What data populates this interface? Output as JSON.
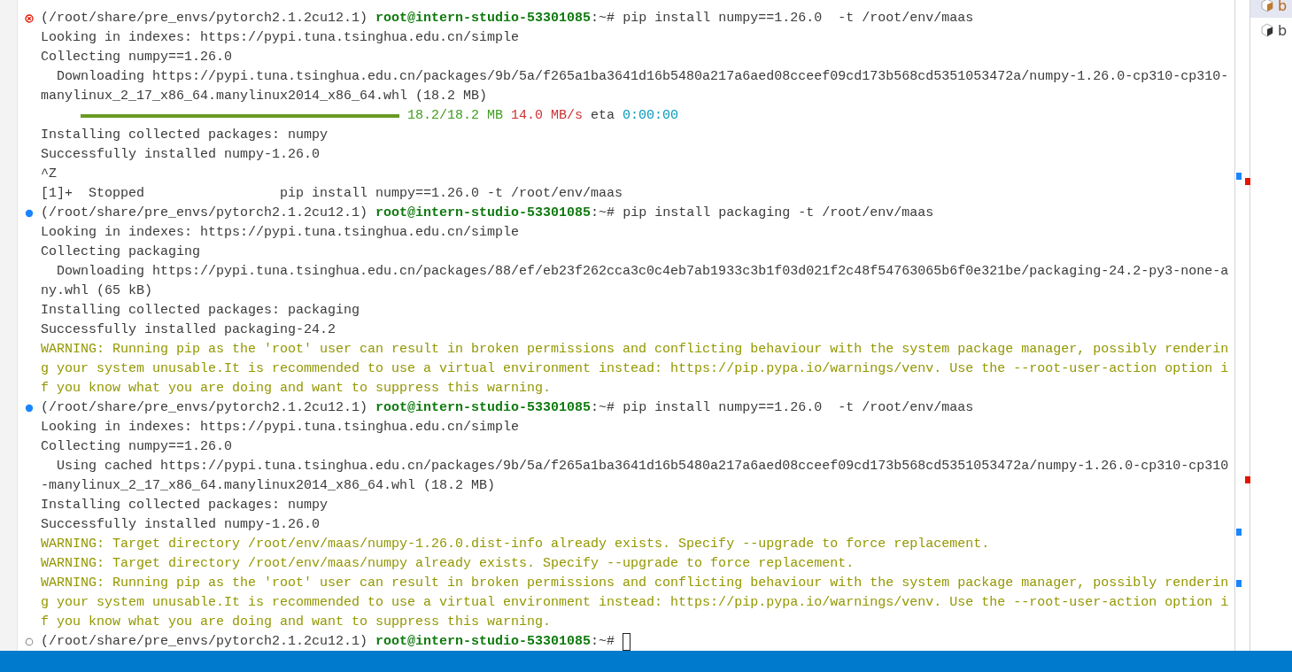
{
  "terminal": {
    "lines": [
      {
        "kind": "prompt",
        "finished": true,
        "failed": true,
        "env": "(/root/share/pre_envs/pytorch2.1.2cu12.1)",
        "userhost": "root@intern-studio-53301085",
        "path": ":~#",
        "command": "pip install numpy==1.26.0  -t /root/env/maas"
      },
      {
        "kind": "output",
        "text": "Looking in indexes: https://pypi.tuna.tsinghua.edu.cn/simple"
      },
      {
        "kind": "output",
        "text": "Collecting numpy==1.26.0"
      },
      {
        "kind": "output",
        "text": "  Downloading https://pypi.tuna.tsinghua.edu.cn/packages/9b/5a/f265a1ba3641d16b5480a217a6aed08cceef09cd173b568cd5351053472a/numpy-1.26.0-cp310-cp310-"
      },
      {
        "kind": "output",
        "text": "manylinux_2_17_x86_64.manylinux2014_x86_64.whl (18.2 MB)"
      },
      {
        "kind": "progress",
        "level": 1,
        "size": "18.2/18.2 MB",
        "speed": "14.0 MB/s",
        "eta_label": "eta",
        "eta": "0:00:00"
      },
      {
        "kind": "output",
        "text": "Installing collected packages: numpy"
      },
      {
        "kind": "output",
        "text": "Successfully installed numpy-1.26.0"
      },
      {
        "kind": "output",
        "text": "^Z"
      },
      {
        "kind": "output",
        "text": "[1]+  Stopped                 pip install numpy==1.26.0 -t /root/env/maas"
      },
      {
        "kind": "prompt",
        "finished": true,
        "failed": false,
        "env": "(/root/share/pre_envs/pytorch2.1.2cu12.1)",
        "userhost": "root@intern-studio-53301085",
        "path": ":~#",
        "command": "pip install packaging -t /root/env/maas"
      },
      {
        "kind": "output",
        "text": "Looking in indexes: https://pypi.tuna.tsinghua.edu.cn/simple"
      },
      {
        "kind": "output",
        "text": "Collecting packaging"
      },
      {
        "kind": "output",
        "text": "  Downloading https://pypi.tuna.tsinghua.edu.cn/packages/88/ef/eb23f262cca3c0c4eb7ab1933c3b1f03d021f2c48f54763065b6f0e321be/packaging-24.2-py3-none-a"
      },
      {
        "kind": "output",
        "text": "ny.whl (65 kB)"
      },
      {
        "kind": "output",
        "text": "Installing collected packages: packaging"
      },
      {
        "kind": "output",
        "text": "Successfully installed packaging-24.2"
      },
      {
        "kind": "warning",
        "text": "WARNING: Running pip as the 'root' user can result in broken permissions and conflicting behaviour with the system package manager, possibly renderin"
      },
      {
        "kind": "warning",
        "text": "g your system unusable.It is recommended to use a virtual environment instead: https://pip.pypa.io/warnings/venv. Use the --root-user-action option i"
      },
      {
        "kind": "warning",
        "text": "f you know what you are doing and want to suppress this warning."
      },
      {
        "kind": "prompt",
        "finished": true,
        "failed": false,
        "env": "(/root/share/pre_envs/pytorch2.1.2cu12.1)",
        "userhost": "root@intern-studio-53301085",
        "path": ":~#",
        "command": "pip install numpy==1.26.0  -t /root/env/maas"
      },
      {
        "kind": "output",
        "text": "Looking in indexes: https://pypi.tuna.tsinghua.edu.cn/simple"
      },
      {
        "kind": "output",
        "text": "Collecting numpy==1.26.0"
      },
      {
        "kind": "output",
        "text": "  Using cached https://pypi.tuna.tsinghua.edu.cn/packages/9b/5a/f265a1ba3641d16b5480a217a6aed08cceef09cd173b568cd5351053472a/numpy-1.26.0-cp310-cp310"
      },
      {
        "kind": "output",
        "text": "-manylinux_2_17_x86_64.manylinux2014_x86_64.whl (18.2 MB)"
      },
      {
        "kind": "output",
        "text": "Installing collected packages: numpy"
      },
      {
        "kind": "output",
        "text": "Successfully installed numpy-1.26.0"
      },
      {
        "kind": "warning",
        "text": "WARNING: Target directory /root/env/maas/numpy-1.26.0.dist-info already exists. Specify --upgrade to force replacement."
      },
      {
        "kind": "warning",
        "text": "WARNING: Target directory /root/env/maas/numpy already exists. Specify --upgrade to force replacement."
      },
      {
        "kind": "warning",
        "text": "WARNING: Running pip as the 'root' user can result in broken permissions and conflicting behaviour with the system package manager, possibly renderin"
      },
      {
        "kind": "warning",
        "text": "g your system unusable.It is recommended to use a virtual environment instead: https://pip.pypa.io/warnings/venv. Use the --root-user-action option i"
      },
      {
        "kind": "warning",
        "text": "f you know what you are doing and want to suppress this warning."
      },
      {
        "kind": "prompt",
        "finished": false,
        "env": "(/root/share/pre_envs/pytorch2.1.2cu12.1)",
        "userhost": "root@intern-studio-53301085",
        "path": ":~#",
        "cursor": true
      }
    ]
  },
  "terminal_tabs": [
    {
      "label": "b",
      "selected": true
    },
    {
      "label": "b",
      "selected": false
    }
  ]
}
